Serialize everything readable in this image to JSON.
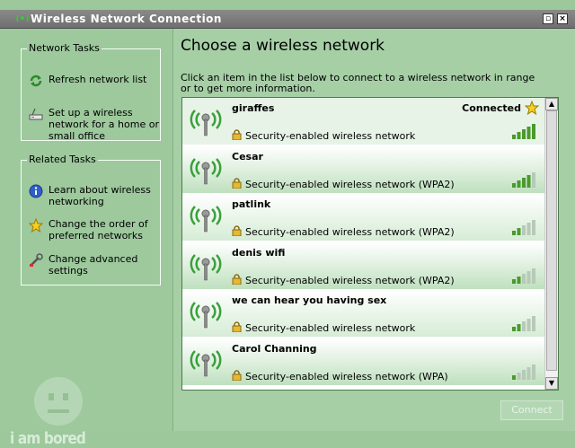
{
  "window": {
    "title": "Wireless Network Connection"
  },
  "left": {
    "network_tasks": {
      "title": "Network Tasks",
      "items": [
        {
          "label": "Refresh network list",
          "icon": "refresh-icon"
        },
        {
          "label": "Set up a wireless network for a home or small office",
          "icon": "setup-wireless-icon"
        }
      ]
    },
    "related_tasks": {
      "title": "Related Tasks",
      "items": [
        {
          "label": "Learn about wireless networking",
          "icon": "info-icon"
        },
        {
          "label": "Change the order of preferred networks",
          "icon": "star-icon"
        },
        {
          "label": "Change advanced settings",
          "icon": "settings-icon"
        }
      ]
    },
    "watermark": "i am bored"
  },
  "main": {
    "heading": "Choose a wireless network",
    "instructions": "Click an item in the list below to connect to a wireless network in range or to get more information.",
    "networks": [
      {
        "name": "giraffes",
        "security": "Security-enabled wireless network",
        "status": "Connected",
        "signal": 5,
        "selected": true
      },
      {
        "name": "Cesar",
        "security": "Security-enabled wireless network (WPA2)",
        "status": "",
        "signal": 4
      },
      {
        "name": "patlink",
        "security": "Security-enabled wireless network (WPA2)",
        "status": "",
        "signal": 2
      },
      {
        "name": "denis wifi",
        "security": "Security-enabled wireless network (WPA2)",
        "status": "",
        "signal": 2
      },
      {
        "name": "we can hear you having sex",
        "security": "Security-enabled wireless network",
        "status": "",
        "signal": 2
      },
      {
        "name": "Carol Channing",
        "security": "Security-enabled wireless network (WPA)",
        "status": "",
        "signal": 1
      }
    ],
    "connect_label": "Connect"
  },
  "colors": {
    "selected_row": "#e7f3e7",
    "row_a": "#bfe0bf",
    "row_b": "#d6ecd6",
    "signal_on": "#4a9a2c",
    "signal_off": "#b7c9b7"
  }
}
